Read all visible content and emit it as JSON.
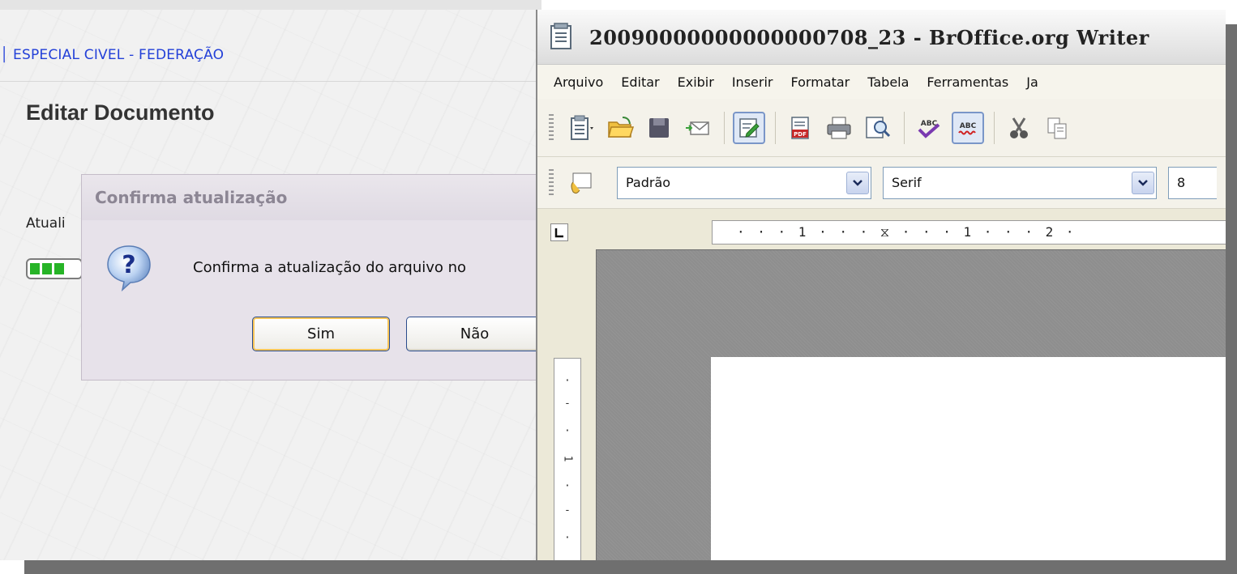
{
  "web_page": {
    "court_header": "│ ESPECIAL CIVEL - FEDERAÇÃO",
    "page_title": "Editar Documento",
    "update_label": "Atuali",
    "progress_fraction": 0.75
  },
  "dialog": {
    "title": "Confirma atualização",
    "message": "Confirma a atualização do arquivo no",
    "yes_label": "Sim",
    "no_label": "Não",
    "icon": "question-icon"
  },
  "writer": {
    "window_title": "20090000000000000708_23 - BrOffice.org Writer",
    "menu": [
      {
        "label": "Arquivo"
      },
      {
        "label": "Editar"
      },
      {
        "label": "Exibir"
      },
      {
        "label": "Inserir"
      },
      {
        "label": "Formatar"
      },
      {
        "label": "Tabela"
      },
      {
        "label": "Ferramentas"
      },
      {
        "label": "Ja"
      }
    ],
    "toolbar_icons": [
      "new-document-icon",
      "open-folder-icon",
      "save-icon",
      "email-icon",
      "edit-file-icon",
      "export-pdf-icon",
      "print-icon",
      "page-preview-icon",
      "spellcheck-icon",
      "autospellcheck-icon",
      "cut-icon",
      "copy-icon"
    ],
    "paragraph_style": "Padrão",
    "font_name": "Serif",
    "font_size": "8",
    "ruler_text": "· · · 1 · · · ⧖ · · · 1 · · · 2 ·",
    "vertical_ruler_marks": [
      "·",
      "-",
      "·",
      "1",
      "·",
      "-",
      "·"
    ]
  },
  "colors": {
    "link_blue": "#2340d8",
    "dialog_bg": "#e7e2ea",
    "window_bg": "#ece9d8",
    "doc_canvas": "#8e8e8e"
  }
}
